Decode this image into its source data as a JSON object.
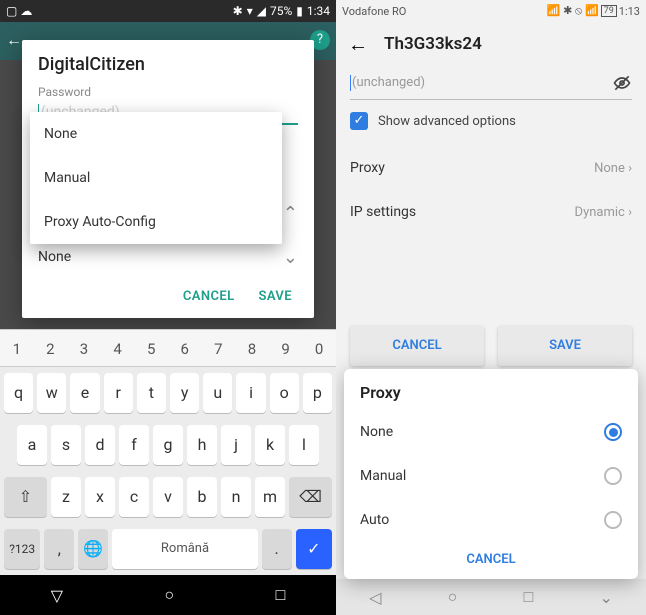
{
  "left": {
    "statusbar": {
      "battery_pct": "75%",
      "time": "1:34"
    },
    "dialog": {
      "title": "DigitalCitizen",
      "password_label": "Password",
      "password_value": "(unchanged)",
      "proxy_dropdown_open_collapse": "^",
      "ip_selected": "None",
      "cancel": "CANCEL",
      "save": "SAVE"
    },
    "proxy_options": [
      "None",
      "Manual",
      "Proxy Auto-Config"
    ],
    "keyboard": {
      "numbers": [
        "1",
        "2",
        "3",
        "4",
        "5",
        "6",
        "7",
        "8",
        "9",
        "0"
      ],
      "row1": [
        "q",
        "w",
        "e",
        "r",
        "t",
        "y",
        "u",
        "i",
        "o",
        "p"
      ],
      "row2": [
        "a",
        "s",
        "d",
        "f",
        "g",
        "h",
        "j",
        "k",
        "l"
      ],
      "row3": [
        "z",
        "x",
        "c",
        "v",
        "b",
        "n",
        "m"
      ],
      "sym": "?123",
      "comma": ",",
      "space_label": "Română",
      "period": "."
    }
  },
  "right": {
    "statusbar": {
      "carrier": "Vodafone RO",
      "battery_pct": "79",
      "time": "1:13"
    },
    "title": "Th3G33ks24",
    "password_placeholder": "(unchanged)",
    "show_advanced": "Show advanced options",
    "proxy_label": "Proxy",
    "proxy_value": "None",
    "ip_label": "IP settings",
    "ip_value": "Dynamic",
    "cancel": "CANCEL",
    "save": "SAVE",
    "sheet": {
      "title": "Proxy",
      "options": [
        "None",
        "Manual",
        "Auto"
      ],
      "selected_index": 0,
      "cancel": "CANCEL"
    }
  }
}
